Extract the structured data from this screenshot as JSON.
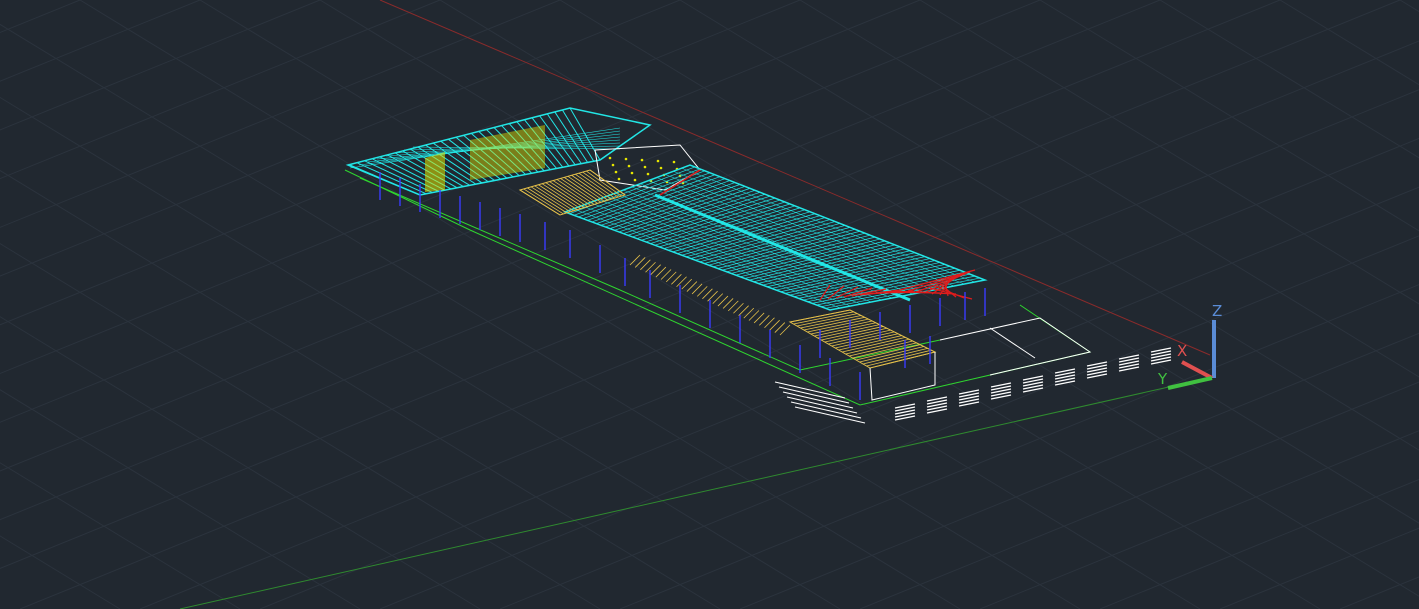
{
  "app": {
    "type": "cad-3d-viewport",
    "visual_style": "wireframe",
    "background_color": "#212830"
  },
  "viewport": {
    "grid": true,
    "grid_color": "#2b333d",
    "x_axis_color": "#8a2b2b",
    "y_axis_color": "#2f8a2f"
  },
  "model": {
    "layer_colors": {
      "roof": "#22e6e6",
      "columns": "#3b3bff",
      "site": "#2fd62f",
      "floor": "#e6c14a",
      "walls": "#ffffff",
      "bracing": "#e01c1c",
      "fill": "#e6e600"
    }
  },
  "ucs_icon": {
    "x_label": "X",
    "y_label": "Y",
    "z_label": "Z",
    "x_color": "#e05050",
    "y_color": "#40c040",
    "z_color": "#5a8cd6"
  }
}
